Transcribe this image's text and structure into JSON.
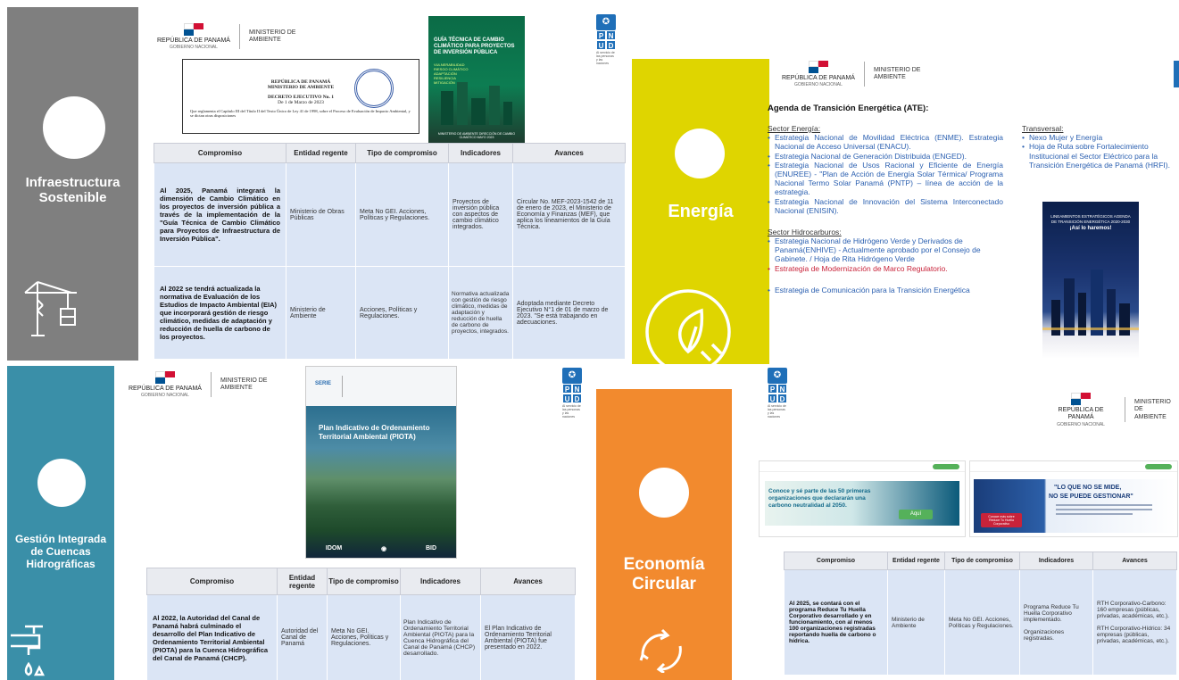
{
  "gov": {
    "republic": "REPÚBLICA DE PANAMÁ",
    "national": "GOBIERNO NACIONAL",
    "ministry_line1": "MINISTERIO DE",
    "ministry_line2": "AMBIENTE"
  },
  "undp": {
    "letters": [
      "P",
      "N",
      "U",
      "D"
    ],
    "note": "Al servicio de las personas y las naciones"
  },
  "infra": {
    "title_line1": "Infraestructura",
    "title_line2": "Sostenible",
    "decree": {
      "rep": "REPÚBLICA DE PANAMÁ",
      "min": "MINISTERIO DE AMBIENTE",
      "title": "DECRETO EJECUTIVO No. 1",
      "date": "De 1   de Marzo de 2023",
      "body": "Que reglamenta el Capítulo III del Título II del Texto Único de Ley 41 de 1998, sobre el Proceso de Evaluación de Impacto Ambiental, y se dictan otras disposiciones"
    },
    "guide_cover": {
      "title": "GUÍA TÉCNICA DE CAMBIO CLIMÁTICO PARA PROYECTOS DE INVERSIÓN PÚBLICA",
      "topics": [
        "VULNERABILIDAD",
        "RIESGO CLIMÁTICO",
        "ADAPTACIÓN",
        "RESILIENCIA",
        "MITIGACIÓN"
      ],
      "footer": "MINISTERIO DE AMBIENTE DIRECCIÓN DE CAMBIO CLIMÁTICO MAYO 2023"
    },
    "headers": [
      "Compromiso",
      "Entidad regente",
      "Tipo de compromiso",
      "Indicadores",
      "Avances"
    ],
    "rows": [
      [
        "Al 2025, Panamá integrará la dimensión de Cambio Climático en los proyectos de inversión pública a través de la implementación de la \"Guía Técnica de Cambio Climático para Proyectos de Infraestructura de Inversión Pública\".",
        "Ministerio de Obras Públicas",
        "Meta No GEI. Acciones, Políticas y Regulaciones.",
        "Proyectos de inversión pública con aspectos de cambio climático integrados.",
        "Circular No. MEF-2023-1542 de 11 de enero de 2023, el Ministerio de Economía y Finanzas (MEF), que aplica los lineamientos de la Guía Técnica."
      ],
      [
        "Al 2022 se tendrá actualizada la normativa de Evaluación de los Estudios de Impacto Ambiental (EIA) que incorporará gestión de riesgo climático, medidas de adaptación y reducción de huella de carbono de los proyectos.",
        "Ministerio de Ambiente",
        "Acciones, Políticas y Regulaciones.",
        "Normativa actualizada con gestión de riesgo climático, medidas de adaptación y reducción de huella de carbono de proyectos, integrados.",
        "Adoptada mediante Decreto Ejecutivo N°1 de 01 de marzo de 2023. \"Se está trabajando en adecuaciones."
      ]
    ]
  },
  "energy": {
    "title": "Energía",
    "heading": "Agenda de Transición Energética (ATE):",
    "sector_energia": "Sector Energía:",
    "energia_items": [
      "Estrategia Nacional de Movilidad Eléctrica (ENME). Estrategia Nacional de Acceso Universal (ENACU).",
      "Estrategia Nacional de Generación Distribuida (ENGED).",
      "Estrategia Nacional de Usos Racional y Eficiente de Energía (ENUREE) - \"Plan de Acción de Energía Solar Térmica/ Programa Nacional Termo Solar Panamá (PNTP) – línea de acción de la estrategia.",
      "Estrategia Nacional de Innovación del Sistema Interconectado Nacional (ENISIN)."
    ],
    "sector_hidro": "Sector Hidrocarburos:",
    "hidro_item1": "Estrategia Nacional de Hidrógeno Verde y Derivados de Panamá(ENHIVE) - Actualmente aprobado por el Consejo de Gabinete. / Hoja de Rita Hidrógeno Verde",
    "hidro_item2": "Estrategia de Modernización de Marco Regulatorio.",
    "comm": "Estrategia de Comunicación para la Transición Energética",
    "transversal": "Transversal:",
    "trans_items": [
      "Nexo Mujer y Energía",
      "Hoja de Ruta sobre Fortalecimiento Institucional el Sector Eléctrico para la Transición Energética de Panamá (HRFI)."
    ],
    "cover": {
      "title": "LINEAMIENTOS ESTRATÉGICOS AGENDA DE TRANSICIÓN ENERGÉTICA 2020-2030",
      "slogan": "¡Así lo haremos!"
    }
  },
  "cuencas": {
    "title_line1": "Gestión Integrada",
    "title_line2": "de Cuencas",
    "title_line3": "Hidrográficas",
    "cover": {
      "serie": "SERIE",
      "title": "Plan Indicativo de Ordenamiento Territorial Ambiental (PIOTA)",
      "brand1": "IDOM",
      "brand2": "BID"
    },
    "headers": [
      "Compromiso",
      "Entidad regente",
      "Tipo de compromiso",
      "Indicadores",
      "Avances"
    ],
    "row": [
      "Al 2022, la Autoridad del Canal de Panamá habrá culminado el desarrollo del Plan Indicativo de Ordenamiento Territorial Ambiental (PIOTA) para la Cuenca Hidrográfica del Canal de Panamá (CHCP).",
      "Autoridad del Canal de Panamá",
      "Meta No GEI. Acciones, Políticas y Regulaciones.",
      "Plan Indicativo de Ordenamiento Territorial Ambiental (PIOTA) para la Cuenca Hidrográfica del Canal de Panamá (CHCP) desarrollado.",
      "El Plan Indicativo de Ordenamiento Territorial Ambiental (PIOTA) fue presentado en 2022."
    ]
  },
  "circular": {
    "title_line1": "Economía",
    "title_line2": "Circular",
    "banner1": {
      "text": "Conoce y sé parte de las 50 primeras organizaciones que declararán una carbono neutralidad al 2050.",
      "button": "Aquí"
    },
    "banner2": {
      "headline1": "\"LO QUE NO SE MIDE,",
      "headline2": "NO SE PUEDE GESTIONAR\"",
      "button": "Conoce más sobre Reduce Tu Huella Corporativo"
    },
    "headers": [
      "Compromiso",
      "Entidad regente",
      "Tipo de compromiso",
      "Indicadores",
      "Avances"
    ],
    "row": [
      "Al 2025, se contará con el programa Reduce Tu Huella Corporativo desarrollado y en funcionamiento, con al menos 100 organizaciones registradas reportando huella de carbono o hídrica.",
      "Ministerio de Ambiente",
      "Meta No GEI. Acciones, Políticas y Regulaciones.",
      "Programa Reduce Tu Huella Corporativo implementado.\n\nOrganizaciones registradas.",
      "RTH Corporativo-Carbono: 160 empresas (públicas, privadas, académicas, etc.).\n\nRTH Corporativo-Hídrico: 34 empresas (públicas, privadas, académicas, etc.)."
    ]
  },
  "colors": {
    "infra": "#7f7f7f",
    "energy": "#dfd500",
    "cuencas": "#3a8fa8",
    "circular": "#f28a2e",
    "undp_blue": "#1f6fb8"
  }
}
